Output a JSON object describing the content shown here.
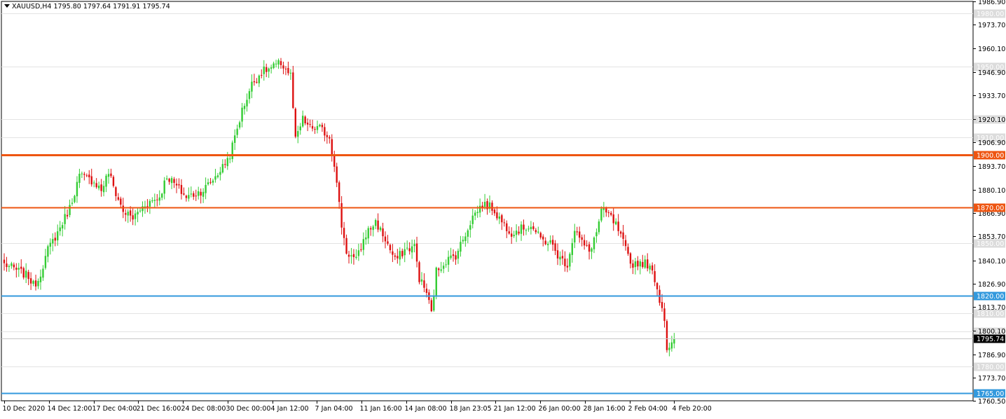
{
  "header": {
    "symbol": "XAUUSD,H4",
    "open": "1795.80",
    "high": "1797.64",
    "low": "1791.91",
    "close": "1795.74"
  },
  "colors": {
    "background": "#ffffff",
    "grid": "#e3e3e3",
    "bull": "#33cc33",
    "bear": "#dd1111",
    "resistance": "#ee5511",
    "support": "#3399dd",
    "price_tag": "#000000",
    "level_tag_faint": "#dcdcdc"
  },
  "chart_data": {
    "type": "candlestick",
    "symbol": "XAUUSD",
    "timeframe": "H4",
    "ylim": [
      1760.5,
      1986.9
    ],
    "grid": true,
    "y_ticks": [
      "1986.90",
      "1973.70",
      "1960.10",
      "1946.90",
      "1933.70",
      "1920.10",
      "1906.90",
      "1893.70",
      "1880.10",
      "1866.90",
      "1853.70",
      "1840.10",
      "1826.90",
      "1813.70",
      "1800.10",
      "1786.90",
      "1773.70",
      "1760.50"
    ],
    "x_ticks": [
      "10 Dec 2020",
      "14 Dec 12:00",
      "17 Dec 04:00",
      "21 Dec 16:00",
      "24 Dec 08:00",
      "30 Dec 00:00",
      "4 Jan 12:00",
      "7 Jan 04:00",
      "11 Jan 16:00",
      "14 Jan 08:00",
      "18 Jan 23:05",
      "21 Jan 12:00",
      "26 Jan 00:00",
      "28 Jan 16:00",
      "2 Feb 04:00",
      "4 Feb 20:00"
    ],
    "horizontal_lines": [
      {
        "price": 1900.0,
        "label": "1900.00",
        "color": "#ee5511",
        "style": "resistance-thick"
      },
      {
        "price": 1870.0,
        "label": "1870.00",
        "color": "#ee5511",
        "style": "resistance"
      },
      {
        "price": 1820.0,
        "label": "1820.00",
        "color": "#3399dd",
        "style": "support"
      },
      {
        "price": 1765.0,
        "label": "1765.00",
        "color": "#3399dd",
        "style": "support"
      }
    ],
    "faint_levels": [
      {
        "price": 1980.0,
        "label": "1980.00"
      },
      {
        "price": 1950.0,
        "label": "1950.00"
      },
      {
        "price": 1920.0,
        "label": "1920.00"
      },
      {
        "price": 1910.0,
        "label": "1910.00"
      },
      {
        "price": 1850.0,
        "label": "1850.00"
      },
      {
        "price": 1810.0,
        "label": "1810.00"
      },
      {
        "price": 1800.0,
        "label": "1800.00"
      },
      {
        "price": 1780.0,
        "label": "1780.00"
      }
    ],
    "current_price": {
      "price": 1795.74,
      "label": "1795.74"
    },
    "swing_path": [
      [
        0,
        1838
      ],
      [
        6,
        1834
      ],
      [
        10,
        1831
      ],
      [
        12,
        1826
      ],
      [
        14,
        1829
      ],
      [
        18,
        1846
      ],
      [
        22,
        1856
      ],
      [
        27,
        1870
      ],
      [
        31,
        1888
      ],
      [
        37,
        1885
      ],
      [
        40,
        1880
      ],
      [
        43,
        1890
      ],
      [
        46,
        1878
      ],
      [
        49,
        1868
      ],
      [
        53,
        1864
      ],
      [
        58,
        1872
      ],
      [
        64,
        1876
      ],
      [
        67,
        1888
      ],
      [
        71,
        1882
      ],
      [
        75,
        1876
      ],
      [
        79,
        1878
      ],
      [
        82,
        1880
      ],
      [
        86,
        1886
      ],
      [
        90,
        1893
      ],
      [
        93,
        1900
      ],
      [
        95,
        1910
      ],
      [
        98,
        1925
      ],
      [
        102,
        1940
      ],
      [
        106,
        1947
      ],
      [
        110,
        1949
      ],
      [
        114,
        1952
      ],
      [
        118,
        1945
      ],
      [
        120,
        1908
      ],
      [
        123,
        1920
      ],
      [
        126,
        1915
      ],
      [
        130,
        1915
      ],
      [
        134,
        1910
      ],
      [
        136,
        1895
      ],
      [
        139,
        1860
      ],
      [
        141,
        1845
      ],
      [
        145,
        1840
      ],
      [
        149,
        1855
      ],
      [
        153,
        1862
      ],
      [
        157,
        1852
      ],
      [
        161,
        1840
      ],
      [
        165,
        1846
      ],
      [
        169,
        1848
      ],
      [
        171,
        1830
      ],
      [
        174,
        1822
      ],
      [
        176,
        1810
      ],
      [
        178,
        1834
      ],
      [
        182,
        1840
      ],
      [
        186,
        1843
      ],
      [
        189,
        1852
      ],
      [
        193,
        1865
      ],
      [
        197,
        1872
      ],
      [
        201,
        1870
      ],
      [
        205,
        1862
      ],
      [
        209,
        1856
      ],
      [
        213,
        1858
      ],
      [
        217,
        1860
      ],
      [
        221,
        1852
      ],
      [
        225,
        1850
      ],
      [
        229,
        1841
      ],
      [
        232,
        1838
      ],
      [
        235,
        1858
      ],
      [
        238,
        1850
      ],
      [
        241,
        1845
      ],
      [
        244,
        1856
      ],
      [
        246,
        1868
      ],
      [
        249,
        1866
      ],
      [
        252,
        1860
      ],
      [
        255,
        1850
      ],
      [
        258,
        1838
      ],
      [
        262,
        1839
      ],
      [
        265,
        1838
      ],
      [
        268,
        1830
      ],
      [
        270,
        1818
      ],
      [
        272,
        1808
      ],
      [
        273,
        1790
      ],
      [
        274,
        1792
      ],
      [
        276,
        1796
      ]
    ]
  }
}
